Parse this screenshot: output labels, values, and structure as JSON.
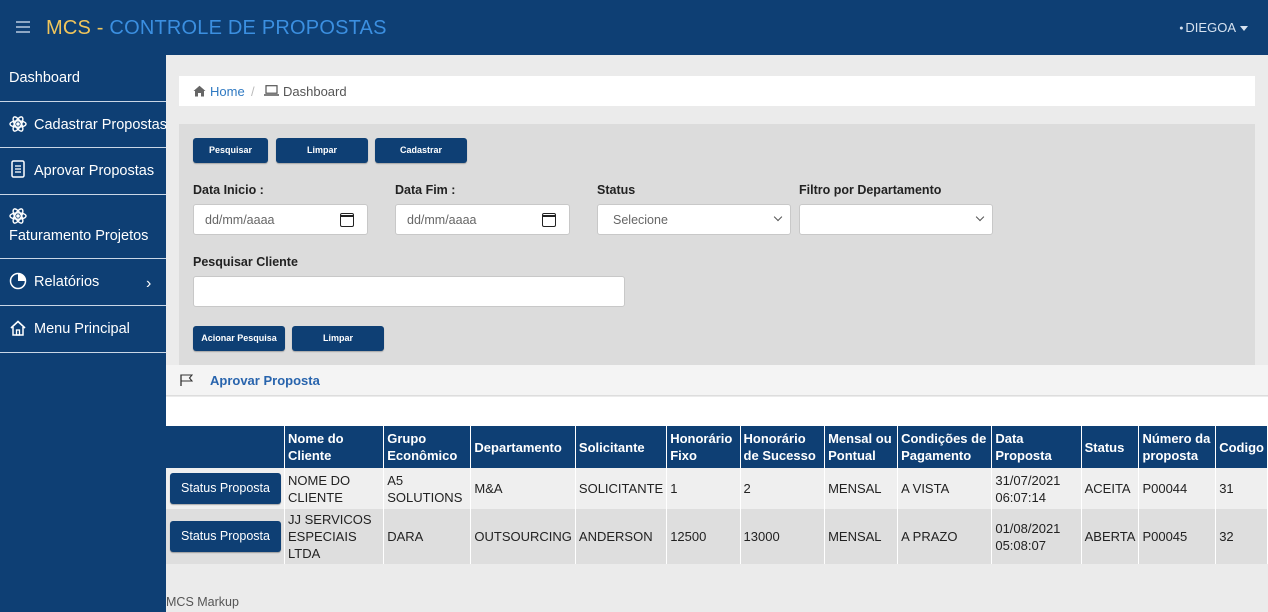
{
  "app": {
    "title_prefix": "MCS - ",
    "title_main": "CONTROLE DE PROPOSTAS",
    "user": "DIEGOA",
    "colors": {
      "navy": "#0e3f74",
      "brand_yellow": "#f0c55b",
      "brand_blue": "#3b8fe0",
      "link": "#2f79c2"
    }
  },
  "sidebar": {
    "items": [
      {
        "label": "Dashboard",
        "icon": ""
      },
      {
        "label": "Cadastrar Propostas",
        "icon": "atom-icon"
      },
      {
        "label": "Aprovar Propostas",
        "icon": "document-list-icon"
      },
      {
        "label": "Faturamento Projetos",
        "icon": "atom-icon"
      },
      {
        "label": "Relatórios",
        "icon": "pie-chart-icon",
        "arrow": "›"
      },
      {
        "label": "Menu Principal",
        "icon": "home-icon"
      }
    ]
  },
  "breadcrumb": {
    "home": "Home",
    "separator": "/",
    "current": "Dashboard"
  },
  "filters": {
    "buttons": {
      "search": "Pesquisar",
      "clear": "Limpar",
      "register": "Cadastrar"
    },
    "date_start": {
      "label": "Data Inicio :",
      "placeholder": "dd/mm/aaaa"
    },
    "date_end": {
      "label": "Data Fim :",
      "placeholder": "dd/mm/aaaa"
    },
    "status": {
      "label": "Status",
      "value": "Selecione"
    },
    "department": {
      "label": "Filtro por Departamento",
      "value": ""
    },
    "client": {
      "label": "Pesquisar Cliente",
      "value": ""
    },
    "action_buttons": {
      "run": "Acionar Pesquisa",
      "clear": "Limpar"
    }
  },
  "approve_section": {
    "title": "Aprovar Proposta"
  },
  "table": {
    "headers": [
      "",
      "Nome do Cliente",
      "Grupo Econômico",
      "Departamento",
      "Solicitante",
      "Honorário Fixo",
      "Honorário de Sucesso",
      "Mensal ou Pontual",
      "Condições de Pagamento",
      "Data Proposta",
      "Status",
      "Número da proposta",
      "Codigo"
    ],
    "status_button": "Status Proposta",
    "rows": [
      {
        "cliente": "NOME DO CLIENTE",
        "grupo": "A5 SOLUTIONS",
        "depto": "M&A",
        "solicitante": "SOLICITANTE",
        "fixo": "1",
        "sucesso": "2",
        "mensal": "MENSAL",
        "condicoes": "A VISTA",
        "data": "31/07/2021 06:07:14",
        "status": "ACEITA",
        "numero": "P00044",
        "codigo": "31"
      },
      {
        "cliente": "JJ SERVICOS ESPECIAIS LTDA",
        "grupo": "DARA",
        "depto": "OUTSOURCING",
        "solicitante": "ANDERSON",
        "fixo": "12500",
        "sucesso": "13000",
        "mensal": "MENSAL",
        "condicoes": "A PRAZO",
        "data": "01/08/2021 05:08:07",
        "status": "ABERTA",
        "numero": "P00045",
        "codigo": "32"
      }
    ]
  },
  "footer": {
    "text": "MCS Markup"
  }
}
